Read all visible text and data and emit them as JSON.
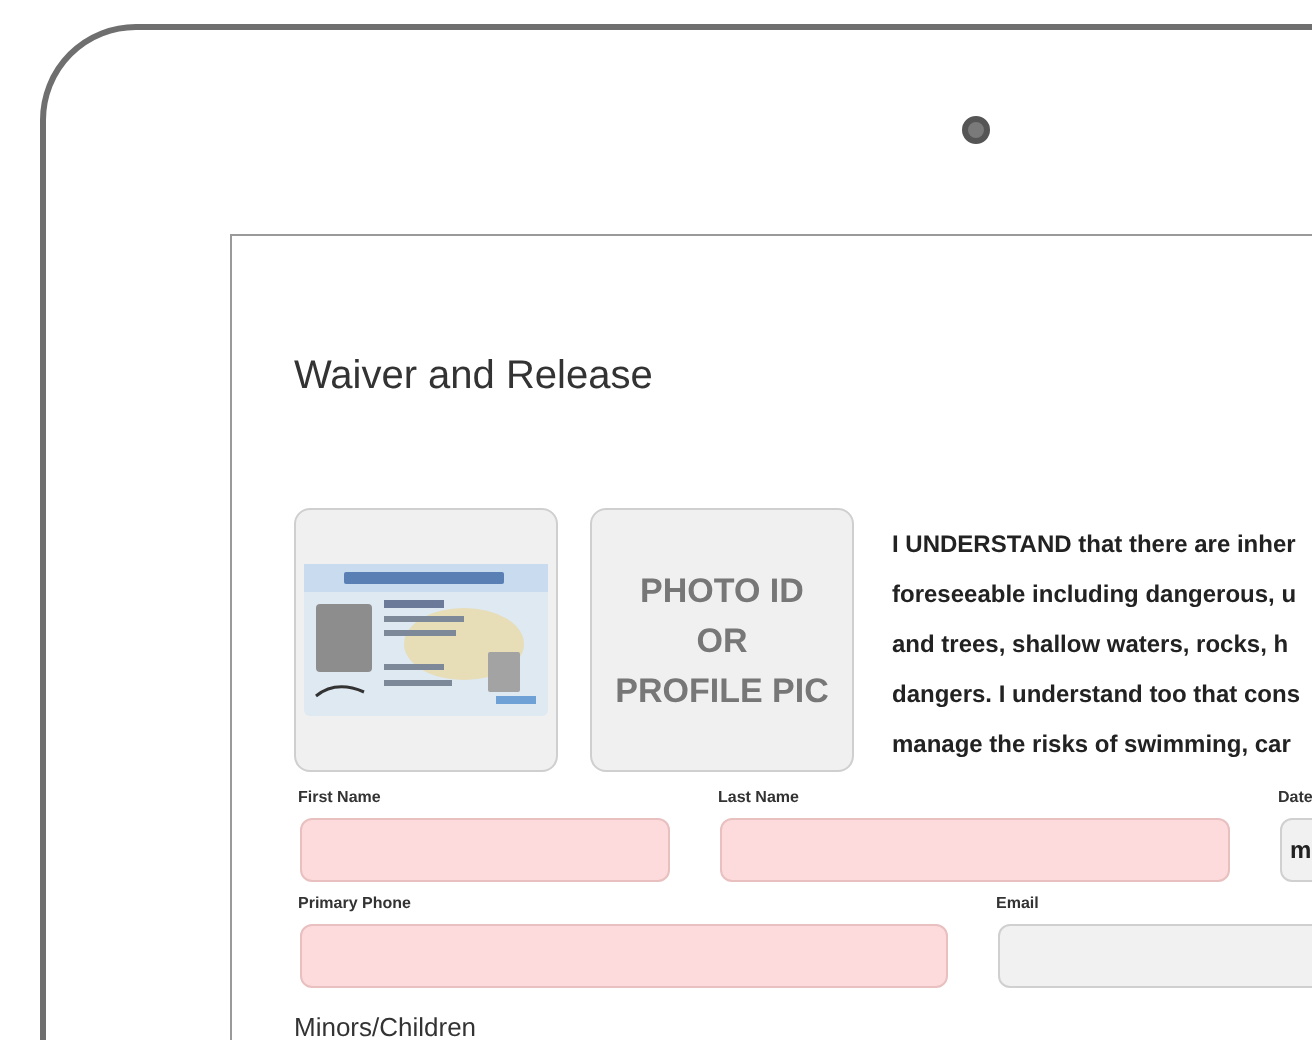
{
  "title": "Waiver and Release",
  "photo_slots": [
    {
      "kind": "picture"
    },
    {
      "kind": "placeholder",
      "lines": [
        "PHOTO ID",
        "OR",
        "PROFILE PIC"
      ]
    }
  ],
  "agreement_lines": [
    "I UNDERSTAND that there are inher",
    "foreseeable including dangerous, u",
    "and trees, shallow waters, rocks, h",
    "dangers. I understand too that cons",
    "manage the risks of swimming, car"
  ],
  "field_rows": [
    {
      "fields": [
        {
          "label": "First Name",
          "required": true
        },
        {
          "label": "Last Name",
          "required": true
        },
        {
          "label": "Date",
          "required": false,
          "value": "m"
        }
      ]
    },
    {
      "fields": [
        {
          "label": "Primary Phone",
          "required": true
        },
        {
          "label": "Email",
          "required": false
        }
      ]
    }
  ],
  "section_heading": "Minors/Children"
}
